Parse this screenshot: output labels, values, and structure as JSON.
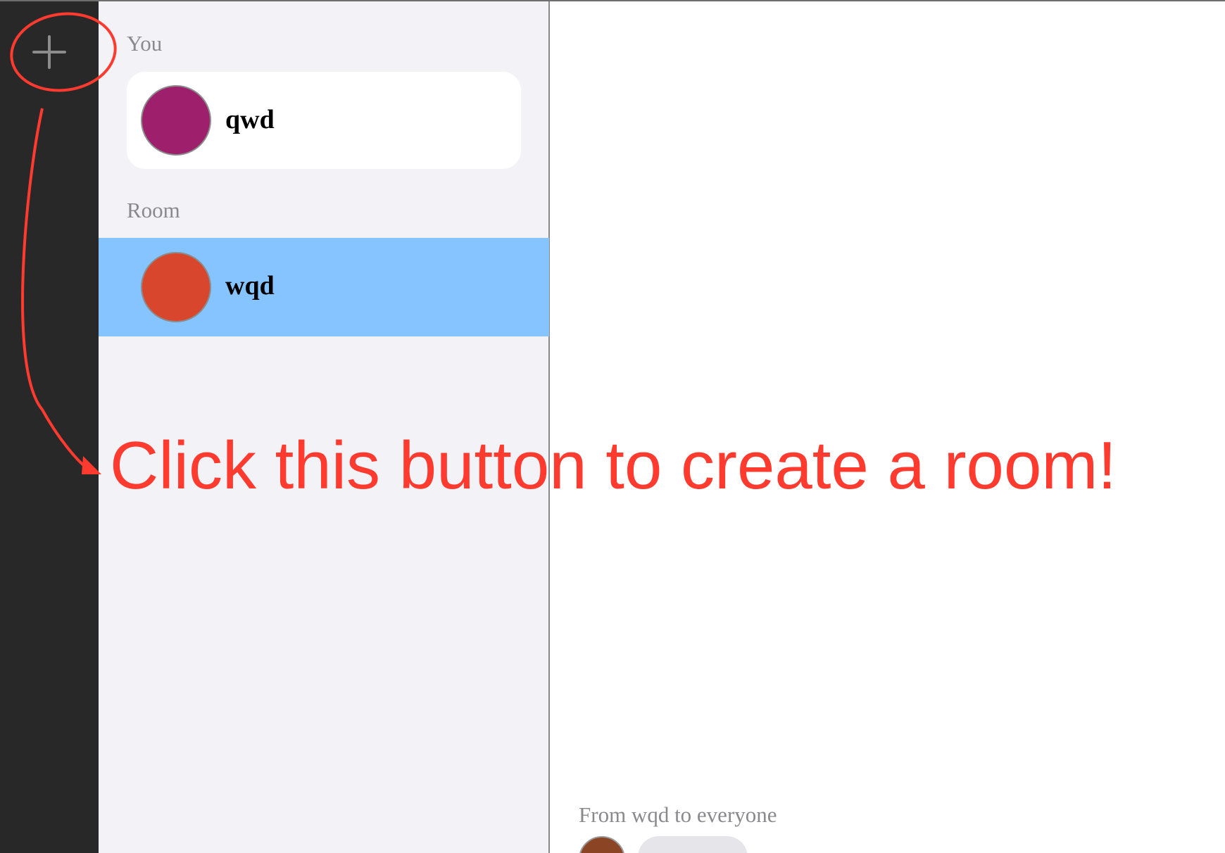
{
  "rail": {
    "add_button_icon": "plus-icon"
  },
  "sidebar": {
    "you_section_label": "You",
    "you": {
      "name": "qwd",
      "avatar_color": "#9e1f6b"
    },
    "room_section_label": "Room",
    "rooms": [
      {
        "name": "wqd",
        "avatar_color": "#d9462e",
        "selected": true
      }
    ],
    "selected_color": "#85c4ff"
  },
  "chat": {
    "message_meta": "From wqd to everyone",
    "message_avatar_color": "#8b4424"
  },
  "annotation": {
    "text": "Click this button to create a room!",
    "color": "#ff3b30"
  }
}
